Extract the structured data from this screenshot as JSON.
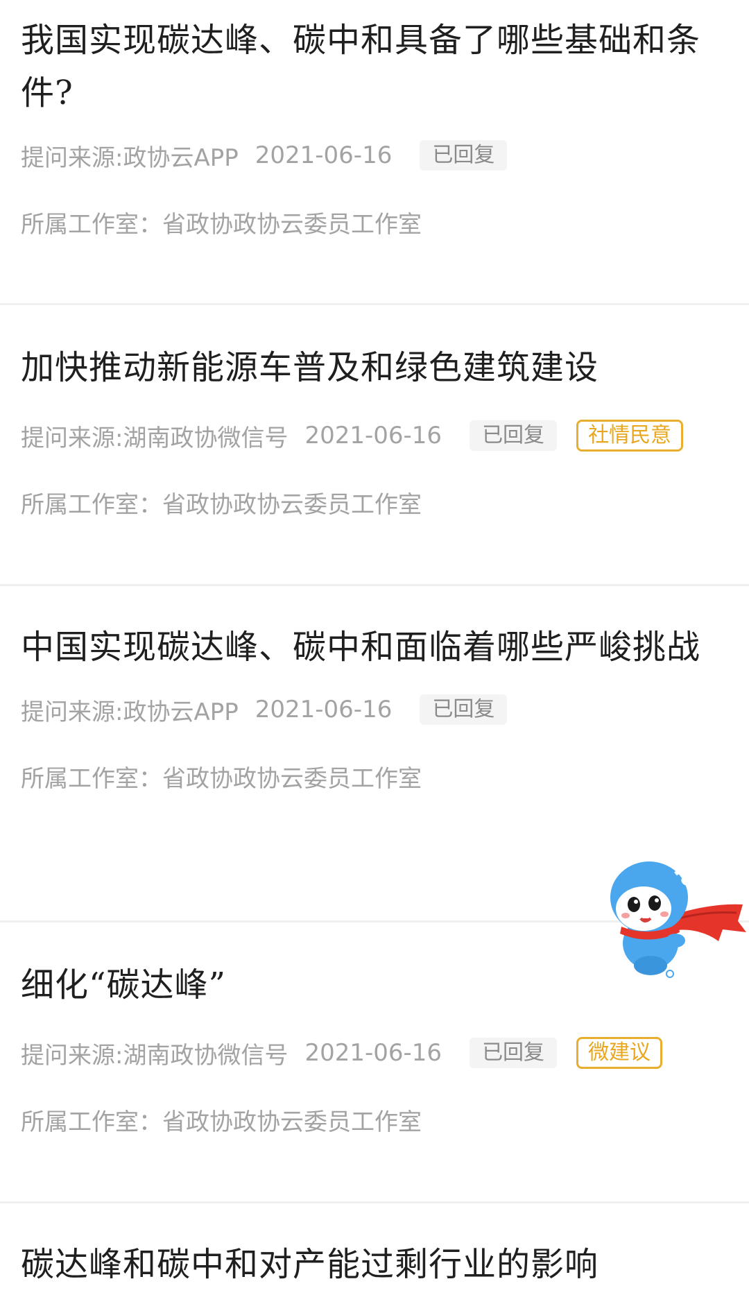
{
  "items": [
    {
      "title": "我国实现碳达峰、碳中和具备了哪些基础和条件?",
      "source": "提问来源:政协云APP",
      "date": "2021-06-16",
      "status": "已回复",
      "tag": "",
      "studio": "所属工作室：省政协政协云委员工作室"
    },
    {
      "title": "加快推动新能源车普及和绿色建筑建设",
      "source": "提问来源:湖南政协微信号",
      "date": "2021-06-16",
      "status": "已回复",
      "tag": "社情民意",
      "studio": "所属工作室：省政协政协云委员工作室"
    },
    {
      "title": "中国实现碳达峰、碳中和面临着哪些严峻挑战",
      "source": "提问来源:政协云APP",
      "date": "2021-06-16",
      "status": "已回复",
      "tag": "",
      "studio": "所属工作室：省政协政协云委员工作室"
    },
    {
      "title": "细化“碳达峰”",
      "source": "提问来源:湖南政协微信号",
      "date": "2021-06-16",
      "status": "已回复",
      "tag": "微建议",
      "studio": "所属工作室：省政协政协云委员工作室"
    },
    {
      "title": "碳达峰和碳中和对产能过剩行业的影响",
      "source": "",
      "date": "",
      "status": "",
      "tag": "",
      "studio": ""
    }
  ],
  "colors": {
    "title": "#1f1f1f",
    "meta": "#a3a3a3",
    "badge_bg": "#f4f4f4",
    "tag": "#e8a71f",
    "divider": "#f0f0f0",
    "mascot_body": "#4aa7ee",
    "mascot_cape": "#e5352b"
  },
  "mascot": {
    "icon": "mascot-icon"
  }
}
